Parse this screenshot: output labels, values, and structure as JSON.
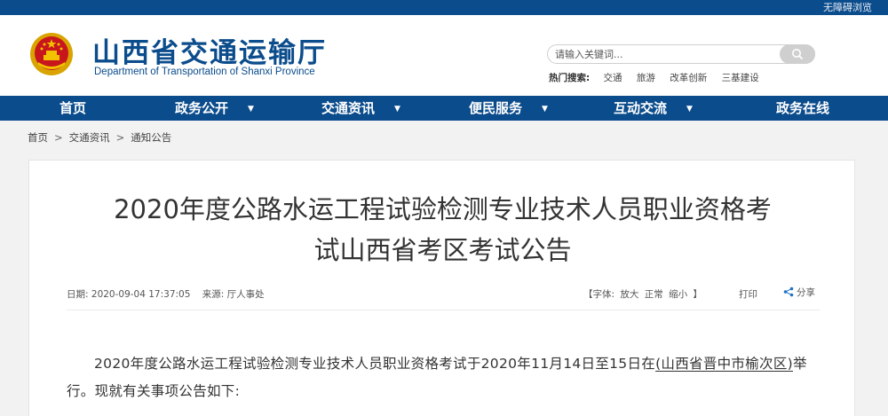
{
  "topbar": {
    "accessibility": "无障碍浏览"
  },
  "header": {
    "title": "山西省交通运输厅",
    "subtitle": "Department of Transportation of Shanxi Province",
    "search_placeholder": "请输入关键词...",
    "hot_label": "热门搜索:",
    "hot_words": [
      "交通",
      "旅游",
      "改革创新",
      "三基建设"
    ]
  },
  "nav": {
    "items": [
      "首页",
      "政务公开",
      "交通资讯",
      "便民服务",
      "互动交流",
      "政务在线"
    ]
  },
  "breadcrumb": [
    "首页",
    "交通资讯",
    "通知公告"
  ],
  "breadcrumb_sep": ">",
  "article": {
    "title_line1": "2020年度公路水运工程试验检测专业技术人员职业资格考",
    "title_line2": "试山西省考区考试公告",
    "date_label": "日期:",
    "date": "2020-09-04 17:37:05",
    "source_label": "来源:",
    "source": "厅人事处",
    "font_open": "【字体:",
    "font_large": "放大",
    "font_normal": "正常",
    "font_small": "缩小",
    "font_close": "】",
    "print": "打印",
    "share": "分享",
    "para_before": "2020年度公路水运工程试验检测专业技术人员职业资格考试于2020年11月14日至15日在",
    "para_underlined": "(山西省晋中市榆次区)",
    "para_after": "举行。现就有关事项公告如下:"
  },
  "colors": {
    "brand_blue": "#0b4c8c",
    "emblem_red": "#c8161d",
    "emblem_gold": "#f2c200"
  }
}
